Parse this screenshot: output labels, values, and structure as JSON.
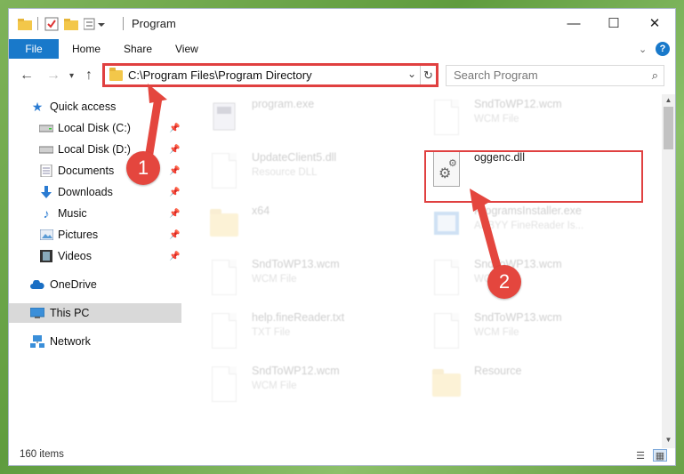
{
  "window": {
    "title": "Program",
    "controls": {
      "minimize": "—",
      "maximize": "☐",
      "close": "✕"
    }
  },
  "ribbon": {
    "tabs": [
      {
        "label": "File",
        "active": true
      },
      {
        "label": "Home"
      },
      {
        "label": "Share"
      },
      {
        "label": "View"
      }
    ],
    "help": "?"
  },
  "address": {
    "path": "C:\\Program Files\\Program Directory",
    "chevron": "⌄",
    "refresh": "↻"
  },
  "search": {
    "placeholder": "Search Program",
    "icon": "search-icon"
  },
  "navpane": {
    "items": [
      {
        "label": "Quick access",
        "icon": "star-icon"
      },
      {
        "label": "Local Disk (C:)",
        "icon": "drive-icon",
        "pinned": true
      },
      {
        "label": "Local Disk (D:)",
        "icon": "drive-icon",
        "pinned": true
      },
      {
        "label": "Documents",
        "icon": "documents-icon",
        "pinned": true
      },
      {
        "label": "Downloads",
        "icon": "downloads-icon",
        "pinned": true
      },
      {
        "label": "Music",
        "icon": "music-icon",
        "pinned": true
      },
      {
        "label": "Pictures",
        "icon": "pictures-icon",
        "pinned": true
      },
      {
        "label": "Videos",
        "icon": "videos-icon",
        "pinned": true
      },
      {
        "label": "OneDrive",
        "icon": "cloud-icon"
      },
      {
        "label": "This PC",
        "icon": "computer-icon",
        "selected": true
      },
      {
        "label": "Network",
        "icon": "network-icon"
      }
    ]
  },
  "files": [
    {
      "name": "program.exe",
      "type": "",
      "icon": "exe-icon",
      "faded": true
    },
    {
      "name": "SndToWP12.wcm",
      "type": "WCM File",
      "icon": "document-icon",
      "faded": true
    },
    {
      "name": "UpdateClient5.dll",
      "type": "Resource DLL",
      "icon": "dll-icon",
      "faded": true
    },
    {
      "name": "oggenc.dll",
      "type": "",
      "icon": "dll-icon",
      "faded": false,
      "highlighted": true
    },
    {
      "name": "x64",
      "type": "",
      "icon": "folder-icon",
      "faded": true
    },
    {
      "name": "ProgramsInstaller.exe",
      "type": "ABBYY FineReader Is...",
      "icon": "installer-icon",
      "faded": true
    },
    {
      "name": "SndToWP13.wcm",
      "type": "WCM File",
      "icon": "document-icon",
      "faded": true
    },
    {
      "name": "SndToWP13.wcm",
      "type": "WCM File",
      "icon": "document-icon",
      "faded": true
    },
    {
      "name": "help.fineReader.txt",
      "type": "TXT File",
      "icon": "document-icon",
      "faded": true
    },
    {
      "name": "SndToWP13.wcm",
      "type": "WCM File",
      "icon": "document-icon",
      "faded": true
    },
    {
      "name": "SndToWP12.wcm",
      "type": "WCM File",
      "icon": "document-icon",
      "faded": true
    },
    {
      "name": "Resource",
      "type": "",
      "icon": "folder-icon",
      "faded": true
    }
  ],
  "status": {
    "count": "160 items"
  },
  "annotations": [
    {
      "number": "1"
    },
    {
      "number": "2"
    }
  ],
  "colors": {
    "accent": "#1979ca",
    "highlight": "#e04040",
    "callout": "#e4463e"
  }
}
